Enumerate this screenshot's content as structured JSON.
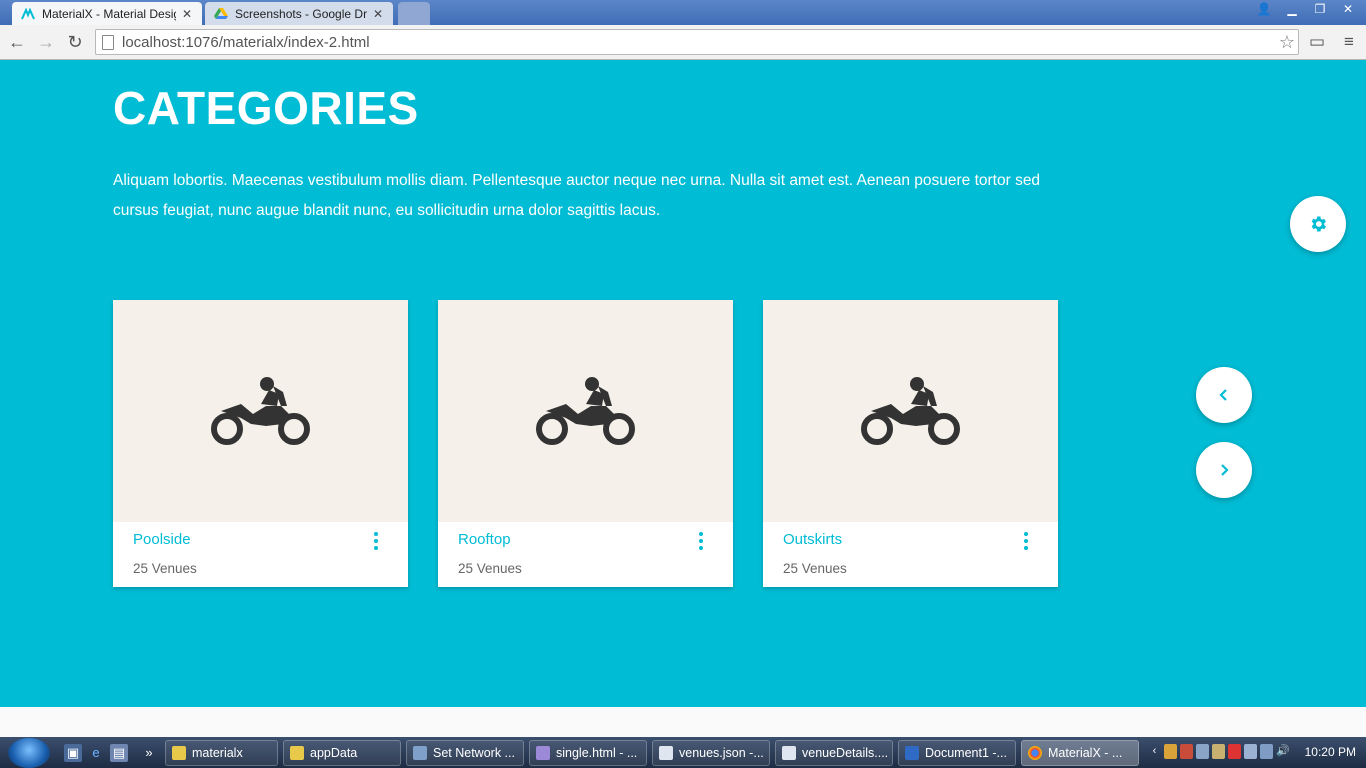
{
  "browser": {
    "tabs": [
      {
        "title": "MaterialX - Material Desig",
        "icon": "materialx-icon"
      },
      {
        "title": "Screenshots - Google Driv",
        "icon": "google-drive-icon"
      }
    ],
    "url": "localhost:1076/materialx/index-2.html"
  },
  "page": {
    "heading": "CATEGORIES",
    "description": "Aliquam lobortis. Maecenas vestibulum mollis diam. Pellentesque auctor neque nec urna. Nulla sit amet est. Aenean posuere tortor sed cursus feugiat, nunc augue blandit nunc, eu sollicitudin urna dolor sagittis lacus.",
    "cards": [
      {
        "title": "Poolside",
        "subtitle": "25 Venues",
        "icon": "motorcycle-icon"
      },
      {
        "title": "Rooftop",
        "subtitle": "25 Venues",
        "icon": "motorcycle-icon"
      },
      {
        "title": "Outskirts",
        "subtitle": "25 Venues",
        "icon": "motorcycle-icon"
      }
    ],
    "accent_color": "#00bcd4",
    "card_media_color": "#f5f1ea"
  },
  "taskbar": {
    "tasks": [
      {
        "label": "materialx"
      },
      {
        "label": "appData"
      },
      {
        "label": "Set Network ..."
      },
      {
        "label": "single.html - ..."
      },
      {
        "label": "venues.json -..."
      },
      {
        "label": "venueDetails...."
      },
      {
        "label": "Document1 -..."
      },
      {
        "label": "MaterialX - ..."
      }
    ],
    "clock": "10:20 PM"
  }
}
